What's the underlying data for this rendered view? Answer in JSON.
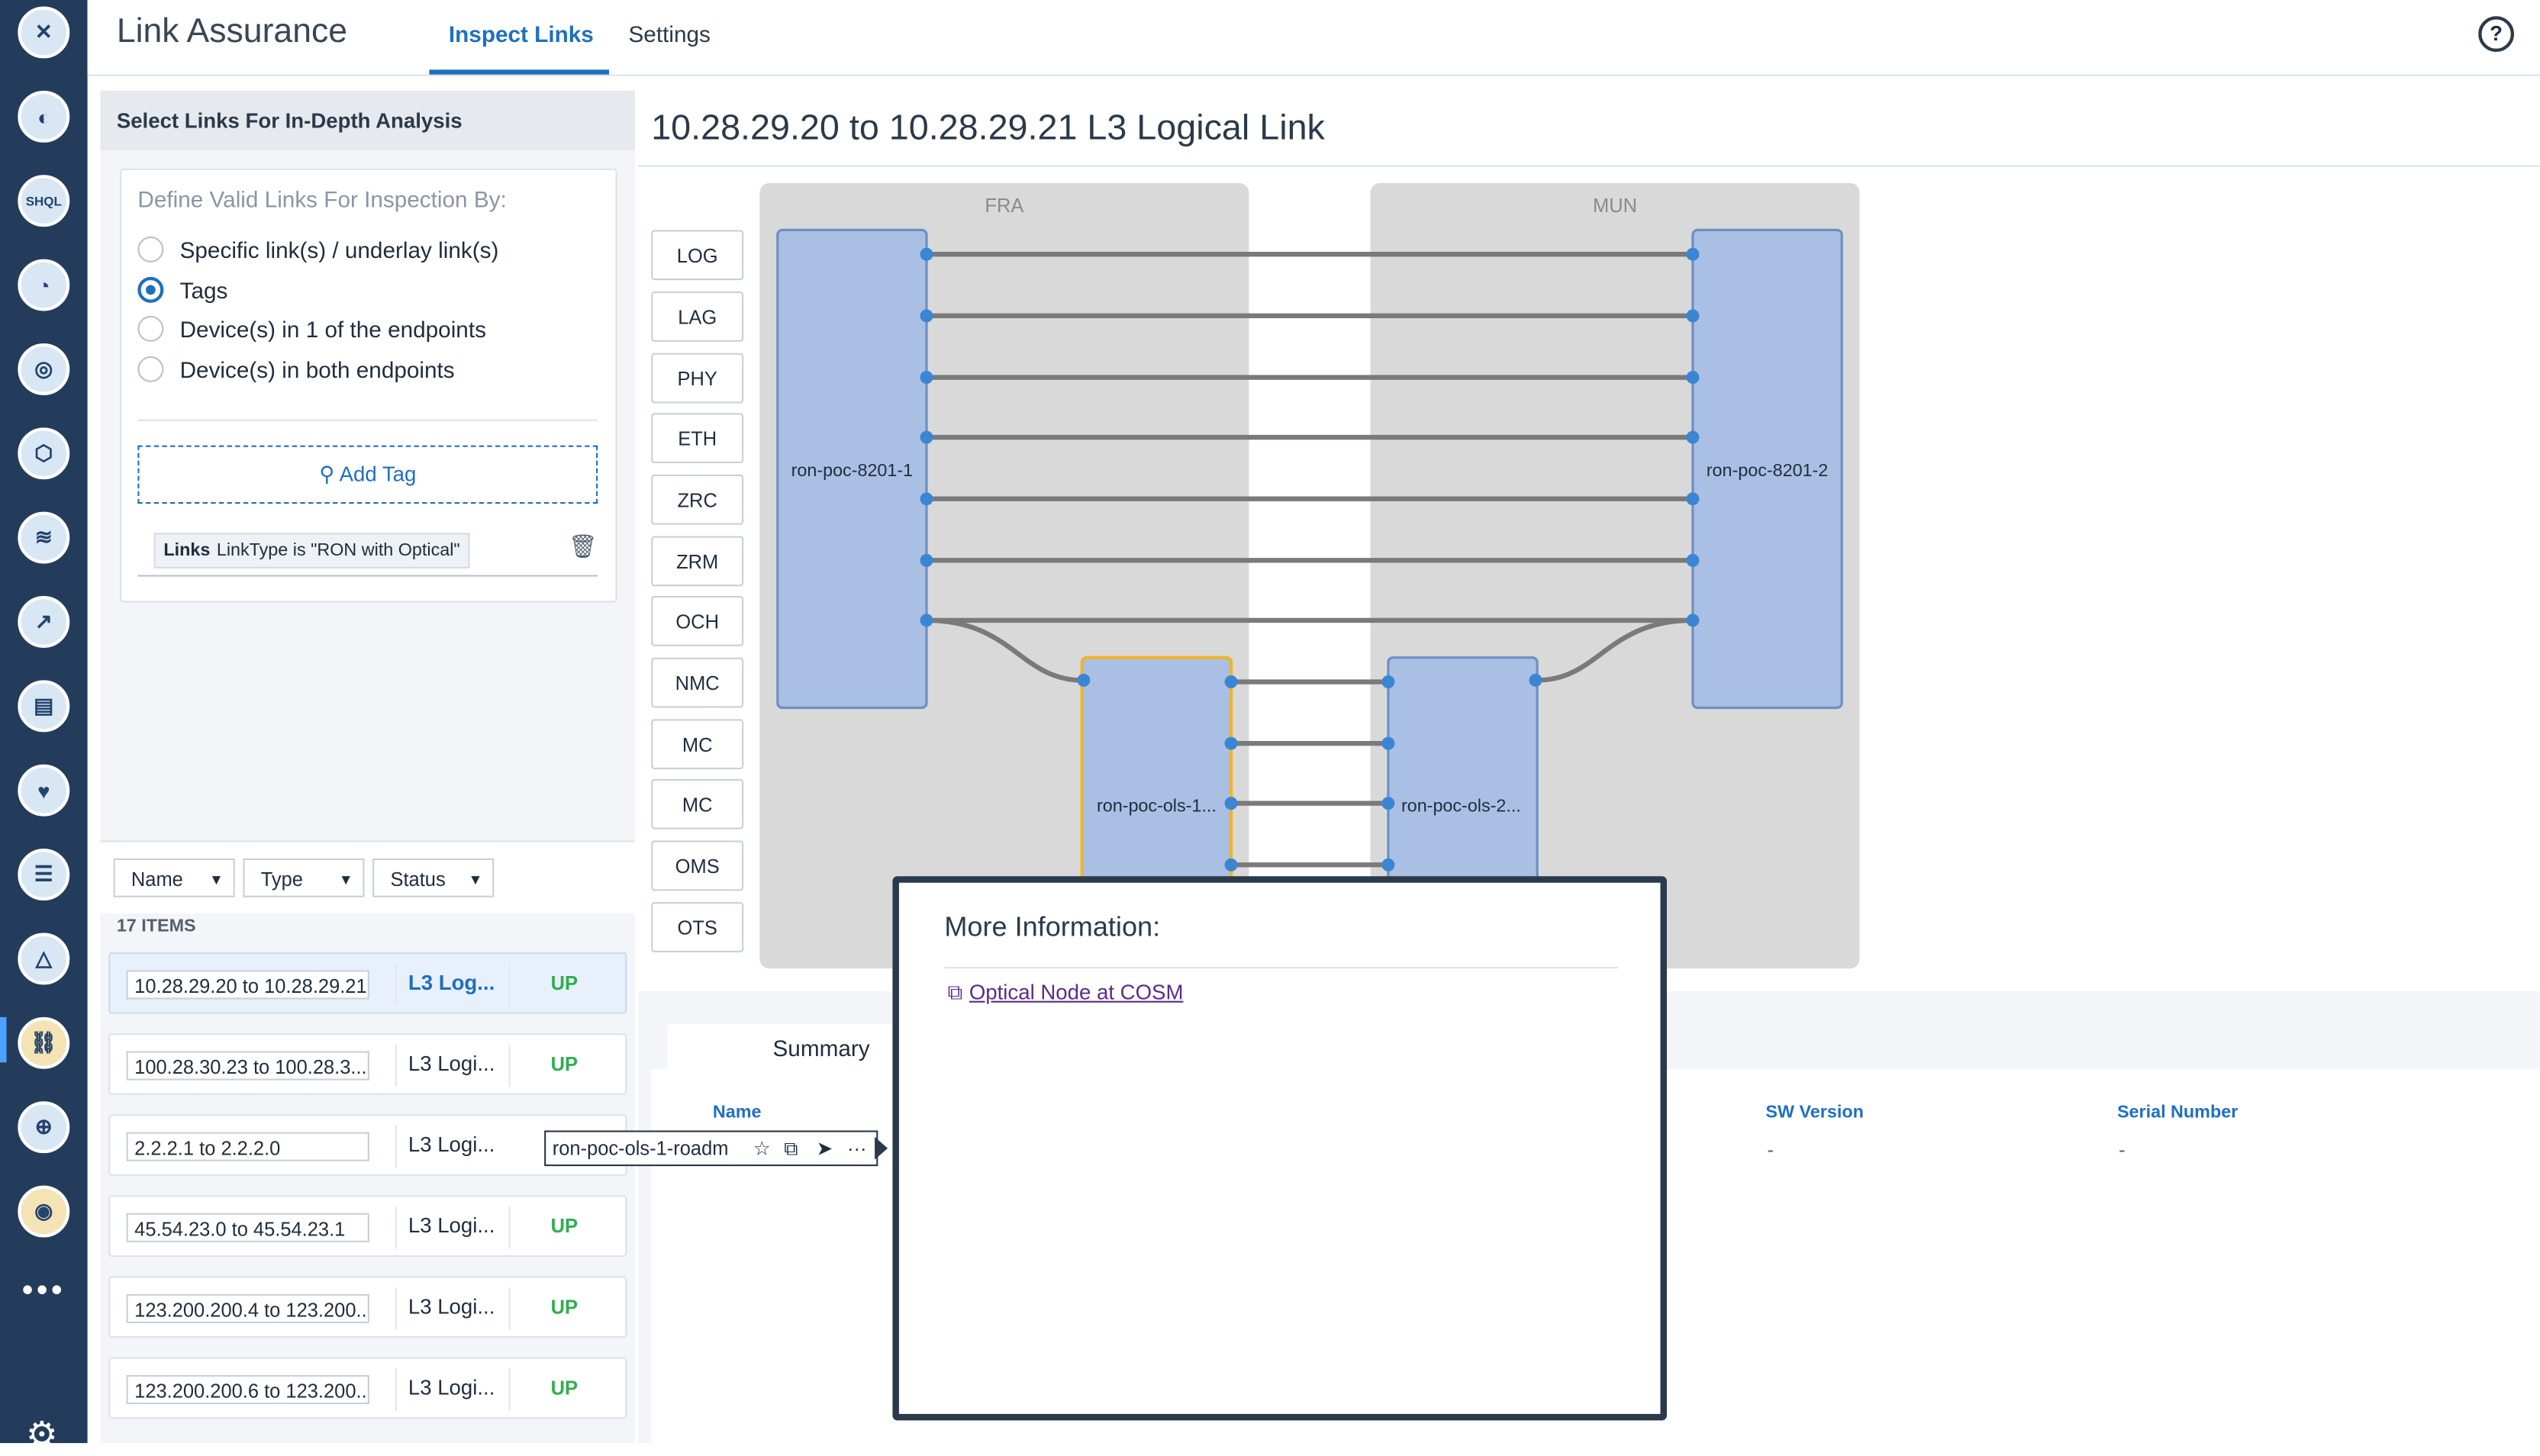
{
  "header": {
    "app_title": "Link Assurance",
    "tab_inspect": "Inspect Links",
    "tab_settings": "Settings",
    "help": "?"
  },
  "rail": {
    "icons": [
      "app-logo-icon",
      "device-icon",
      "shql-icon",
      "profile-icon",
      "audit-icon",
      "network-icon",
      "layers-icon",
      "trend-icon",
      "report-icon",
      "health-icon",
      "checklist-icon",
      "topology-icon",
      "link-assurance-icon",
      "add-app-icon",
      "coins-icon"
    ],
    "shql_text": "SHQL",
    "more": "•••"
  },
  "left": {
    "panel_title": "Select Links For In-Depth Analysis",
    "define_title": "Define Valid Links For Inspection By:",
    "options": [
      "Specific link(s) / underlay link(s)",
      "Tags",
      "Device(s) in 1 of the endpoints",
      "Device(s) in both endpoints"
    ],
    "selected_option": 1,
    "add_tag": "Add Tag",
    "tag": {
      "key": "Links",
      "value": "LinkType is \"RON with Optical\""
    },
    "filters": [
      "Name",
      "Type",
      "Status"
    ],
    "count": "17 ITEMS",
    "links": [
      {
        "name": "10.28.29.20 to 10.28.29.21",
        "type": "L3 Log...",
        "status": "UP"
      },
      {
        "name": "100.28.30.23 to 100.28.3...",
        "type": "L3 Logi...",
        "status": "UP"
      },
      {
        "name": "2.2.2.1 to 2.2.2.0",
        "type": "L3 Logi...",
        "status": ""
      },
      {
        "name": "45.54.23.0 to 45.54.23.1",
        "type": "L3 Logi...",
        "status": "UP"
      },
      {
        "name": "123.200.200.4 to 123.200...",
        "type": "L3 Logi...",
        "status": "UP"
      },
      {
        "name": "123.200.200.6 to 123.200...",
        "type": "L3 Logi...",
        "status": "UP"
      }
    ]
  },
  "main": {
    "title": "10.28.29.20 to 10.28.29.21 L3 Logical Link",
    "layers": [
      "LOG",
      "LAG",
      "PHY",
      "ETH",
      "ZRC",
      "ZRM",
      "OCH",
      "NMC",
      "MC",
      "MC",
      "OMS",
      "OTS"
    ],
    "site_left": "FRA",
    "site_right": "MUN",
    "node_left": "ron-poc-8201-1",
    "node_right": "ron-poc-8201-2",
    "ols_left": "ron-poc-ols-1...",
    "ols_right": "ron-poc-ols-2...",
    "summary_tab": "Summary",
    "columns": {
      "name": "Name",
      "sw_version": "SW Version",
      "serial": "Serial Number"
    },
    "values": {
      "sw_version": "-",
      "serial": "-"
    },
    "tooltip": {
      "text": "ron-poc-ols-1-roadm",
      "star": "☆",
      "open": "⧉",
      "locate": "➤",
      "more": "···"
    },
    "info": {
      "title": "More Information:",
      "link": "Optical Node at COSM",
      "ext": "⧉"
    }
  },
  "colors": {
    "rail": "#243c5c",
    "accent": "#1f6fbf",
    "status_up": "#2fae4e",
    "node_fill": "#a9bfe3",
    "selected_node": "#f0b429"
  }
}
